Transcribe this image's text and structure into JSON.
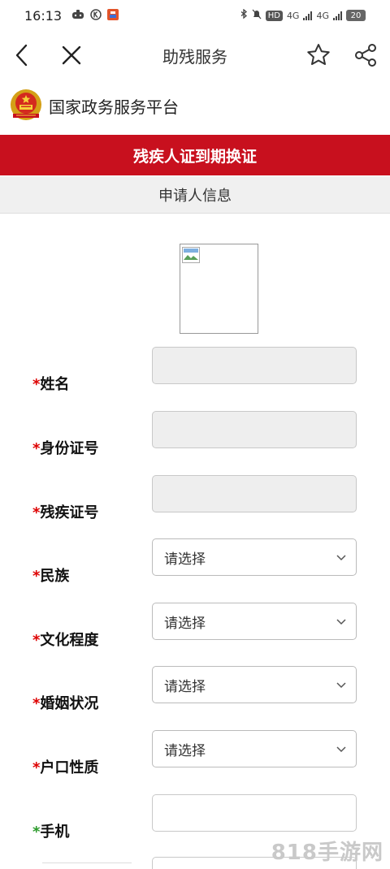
{
  "status_bar": {
    "time": "16:13",
    "left_icons": [
      "game-controller-icon",
      "k-icon",
      "app-icon"
    ],
    "hd_badge": "HD",
    "network_1": "4G",
    "network_2": "4G",
    "battery": "20"
  },
  "nav": {
    "title": "助残服务",
    "back_icon": "chevron-left-icon",
    "close_icon": "close-icon",
    "favorite_icon": "star-icon",
    "share_icon": "share-icon"
  },
  "brand": {
    "name": "国家政务服务平台",
    "emblem_icon": "national-emblem-icon"
  },
  "banner": {
    "title": "残疾人证到期换证"
  },
  "section": {
    "title": "申请人信息"
  },
  "form": {
    "fields": [
      {
        "required_mark": "*",
        "label": "姓名",
        "type": "text-disabled",
        "value": ""
      },
      {
        "required_mark": "*",
        "label": "身份证号",
        "type": "text-disabled",
        "value": ""
      },
      {
        "required_mark": "*",
        "label": "残疾证号",
        "type": "text-disabled",
        "value": ""
      },
      {
        "required_mark": "*",
        "label": "民族",
        "type": "select",
        "value": "请选择"
      },
      {
        "required_mark": "*",
        "label": "文化程度",
        "type": "select",
        "value": "请选择"
      },
      {
        "required_mark": "*",
        "label": "婚姻状况",
        "type": "select",
        "value": "请选择"
      },
      {
        "required_mark": "*",
        "label": "户口性质",
        "type": "select",
        "value": "请选择"
      },
      {
        "required_mark": "*",
        "label": "手机",
        "type": "text",
        "value": ""
      }
    ]
  },
  "watermark": "818手游网",
  "colors": {
    "banner_red": "#c8101e",
    "required_red": "#dd0000",
    "required_green": "#2a9a2a",
    "section_gray": "#f0f0f0"
  }
}
